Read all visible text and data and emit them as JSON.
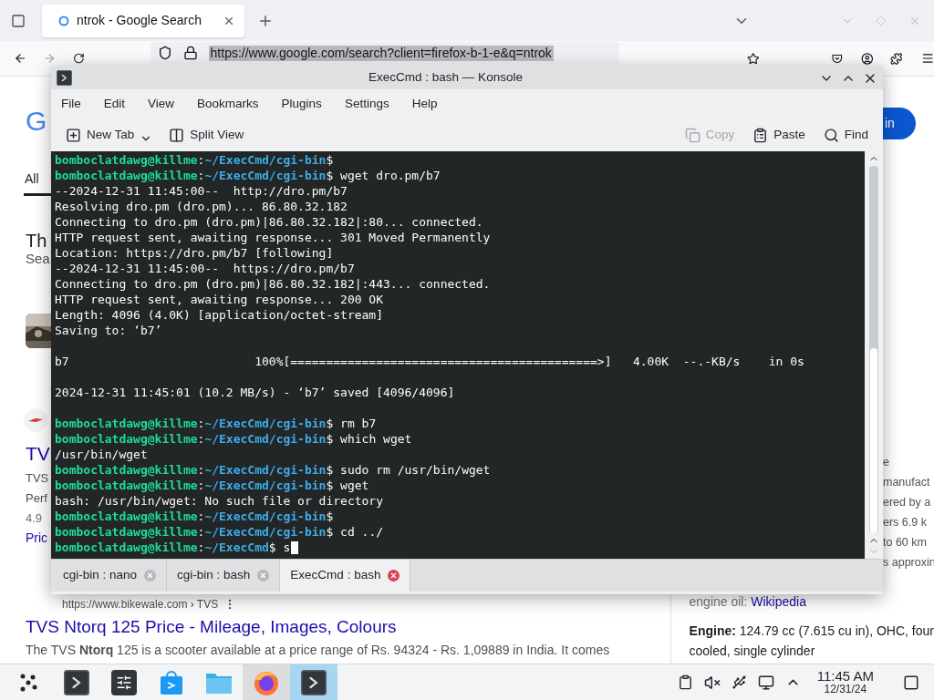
{
  "browser": {
    "tabs": [
      {
        "title": "ntrok - Google Search",
        "selected": true
      }
    ],
    "url": "https://www.google.com/search?client=firefox-b-1-e&q=ntrok",
    "page": {
      "left": [
        {
          "kind": "logo",
          "text": "G"
        },
        {
          "kind": "tab",
          "text": "All"
        },
        {
          "kind": "heading",
          "text": "Th"
        },
        {
          "kind": "sub",
          "text": "Sea"
        },
        {
          "kind": "thumb"
        },
        {
          "kind": "favicon"
        },
        {
          "kind": "title",
          "text": "TV"
        },
        {
          "kind": "snippet",
          "text": "TVS"
        },
        {
          "kind": "snippet",
          "text": "Perf"
        },
        {
          "kind": "rating",
          "text": "4.9"
        },
        {
          "kind": "link",
          "text": "Pric"
        }
      ],
      "right": [
        {
          "kind": "signin",
          "text": "in"
        },
        {
          "kind": "snippet",
          "text": "e"
        },
        {
          "kind": "snippet",
          "text": "manufact"
        },
        {
          "kind": "snippet",
          "text": "ered by a"
        },
        {
          "kind": "snippet",
          "text": "ers 6.9 k"
        },
        {
          "kind": "snippet",
          "text": "to 60 km"
        },
        {
          "kind": "snippet",
          "text": "s approxin"
        }
      ],
      "result": {
        "url": "https://www.bikewale.com › TVS",
        "title": "TVS Ntorq 125 Price - Mileage, Images, Colours",
        "snippet": "The TVS **Ntorq** 125 is a scooter available at a price range of Rs. 94324 - Rs. 1,09889 in India. It comes"
      },
      "panel": [
        {
          "text": "engine oil: ",
          "link": "Wikipedia"
        },
        {
          "text": "**Engine:** 124.79 cc (7.615 cu in), OHC, four"
        },
        {
          "text": "cooled, single cylinder"
        }
      ]
    }
  },
  "konsole": {
    "title": "ExecCmd : bash — Konsole",
    "menu": [
      "File",
      "Edit",
      "View",
      "Bookmarks",
      "Plugins",
      "Settings",
      "Help"
    ],
    "toolbar": [
      {
        "kind": "new-tab",
        "label": "New Tab",
        "disabled": false
      },
      {
        "kind": "split",
        "label": "Split View",
        "disabled": false
      },
      {
        "kind": "copy",
        "label": "Copy",
        "disabled": true
      },
      {
        "kind": "paste",
        "label": "Paste",
        "disabled": false
      },
      {
        "kind": "find",
        "label": "Find",
        "disabled": false
      }
    ],
    "terminal": {
      "lines": [
        {
          "kind": "prompt",
          "segments": [
            {
              "kind": "user",
              "text": "bomboclatdawg@killme"
            },
            {
              "kind": "sep",
              "text": ":"
            },
            {
              "kind": "path",
              "text": "~/ExecCmd/cgi-bin"
            },
            {
              "kind": "cmd",
              "text": "$"
            }
          ]
        },
        {
          "kind": "prompt",
          "segments": [
            {
              "kind": "user",
              "text": "bomboclatdawg@killme"
            },
            {
              "kind": "sep",
              "text": ":"
            },
            {
              "kind": "path",
              "text": "~/ExecCmd/cgi-bin"
            },
            {
              "kind": "cmd",
              "text": "$ wget dro.pm/b7"
            }
          ]
        },
        {
          "kind": "output",
          "text": "--2024-12-31 11:45:00--  http://dro.pm/b7"
        },
        {
          "kind": "output",
          "text": "Resolving dro.pm (dro.pm)... 86.80.32.182"
        },
        {
          "kind": "output",
          "text": "Connecting to dro.pm (dro.pm)|86.80.32.182|:80... connected."
        },
        {
          "kind": "output",
          "text": "HTTP request sent, awaiting response... 301 Moved Permanently"
        },
        {
          "kind": "output",
          "text": "Location: https://dro.pm/b7 [following]"
        },
        {
          "kind": "output",
          "text": "--2024-12-31 11:45:00--  https://dro.pm/b7"
        },
        {
          "kind": "output",
          "text": "Connecting to dro.pm (dro.pm)|86.80.32.182|:443... connected."
        },
        {
          "kind": "output",
          "text": "HTTP request sent, awaiting response... 200 OK"
        },
        {
          "kind": "output",
          "text": "Length: 4096 (4.0K) [application/octet-stream]"
        },
        {
          "kind": "output",
          "text": "Saving to: ‘b7’"
        },
        {
          "kind": "blank"
        },
        {
          "kind": "output",
          "text": "b7                          100%[===========================================>]   4.00K  --.-KB/s    in 0s"
        },
        {
          "kind": "blank"
        },
        {
          "kind": "output",
          "text": "2024-12-31 11:45:01 (10.2 MB/s) - ‘b7’ saved [4096/4096]"
        },
        {
          "kind": "blank"
        },
        {
          "kind": "prompt",
          "segments": [
            {
              "kind": "user",
              "text": "bomboclatdawg@killme"
            },
            {
              "kind": "sep",
              "text": ":"
            },
            {
              "kind": "path",
              "text": "~/ExecCmd/cgi-bin"
            },
            {
              "kind": "cmd",
              "text": "$ rm b7"
            }
          ]
        },
        {
          "kind": "prompt",
          "segments": [
            {
              "kind": "user",
              "text": "bomboclatdawg@killme"
            },
            {
              "kind": "sep",
              "text": ":"
            },
            {
              "kind": "path",
              "text": "~/ExecCmd/cgi-bin"
            },
            {
              "kind": "cmd",
              "text": "$ which wget"
            }
          ]
        },
        {
          "kind": "output",
          "text": "/usr/bin/wget"
        },
        {
          "kind": "prompt",
          "segments": [
            {
              "kind": "user",
              "text": "bomboclatdawg@killme"
            },
            {
              "kind": "sep",
              "text": ":"
            },
            {
              "kind": "path",
              "text": "~/ExecCmd/cgi-bin"
            },
            {
              "kind": "cmd",
              "text": "$ sudo rm /usr/bin/wget"
            }
          ]
        },
        {
          "kind": "prompt",
          "segments": [
            {
              "kind": "user",
              "text": "bomboclatdawg@killme"
            },
            {
              "kind": "sep",
              "text": ":"
            },
            {
              "kind": "path",
              "text": "~/ExecCmd/cgi-bin"
            },
            {
              "kind": "cmd",
              "text": "$ wget"
            }
          ]
        },
        {
          "kind": "output",
          "text": "bash: /usr/bin/wget: No such file or directory"
        },
        {
          "kind": "prompt",
          "segments": [
            {
              "kind": "user",
              "text": "bomboclatdawg@killme"
            },
            {
              "kind": "sep",
              "text": ":"
            },
            {
              "kind": "path",
              "text": "~/ExecCmd/cgi-bin"
            },
            {
              "kind": "cmd",
              "text": "$"
            }
          ]
        },
        {
          "kind": "prompt",
          "segments": [
            {
              "kind": "user",
              "text": "bomboclatdawg@killme"
            },
            {
              "kind": "sep",
              "text": ":"
            },
            {
              "kind": "path",
              "text": "~/ExecCmd/cgi-bin"
            },
            {
              "kind": "cmd",
              "text": "$ cd ../"
            }
          ]
        },
        {
          "kind": "prompt",
          "cursor": true,
          "segments": [
            {
              "kind": "user",
              "text": "bomboclatdawg@killme"
            },
            {
              "kind": "sep",
              "text": ":"
            },
            {
              "kind": "path",
              "text": "~/ExecCmd"
            },
            {
              "kind": "cmd",
              "text": "$ s"
            }
          ]
        }
      ]
    },
    "tabs": [
      {
        "title": "cgi-bin : nano",
        "selected": false
      },
      {
        "title": "cgi-bin : bash",
        "selected": false
      },
      {
        "title": "ExecCmd : bash",
        "selected": true
      }
    ]
  },
  "taskbar": {
    "apps": [
      {
        "kind": "launcher",
        "active": false
      },
      {
        "kind": "terminal",
        "active": false
      },
      {
        "kind": "settings",
        "active": false
      },
      {
        "kind": "store",
        "active": false
      },
      {
        "kind": "files",
        "active": false
      },
      {
        "kind": "firefox",
        "active": true
      },
      {
        "kind": "terminal",
        "active": true
      }
    ],
    "clock": {
      "time": "11:45 AM",
      "date": "12/31/24"
    }
  }
}
